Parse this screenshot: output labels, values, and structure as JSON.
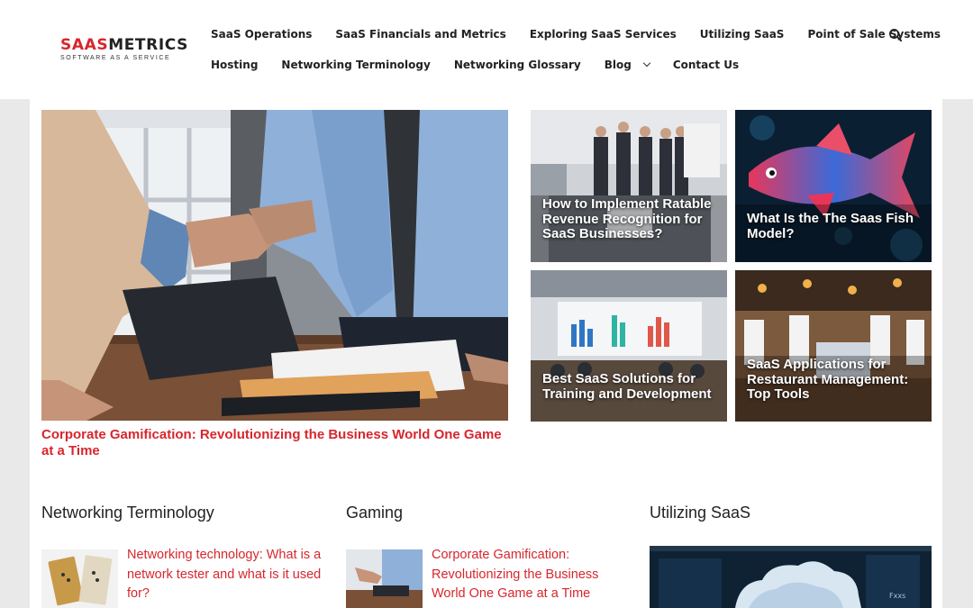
{
  "brand": {
    "logo_red": "SAAS",
    "logo_dark": "METRICS",
    "tagline": "SOFTWARE AS A SERVICE",
    "accent_color": "#d7262d"
  },
  "nav": {
    "row1": [
      "SaaS Operations",
      "SaaS Financials and Metrics",
      "Exploring SaaS Services",
      "Utilizing SaaS",
      "Point of Sale Systems"
    ],
    "row2": [
      "Hosting",
      "Networking Terminology",
      "Networking Glossary",
      "Blog",
      "Contact Us"
    ],
    "search_icon": "search-icon",
    "dropdown_icon": "chevron-down-icon"
  },
  "featured": {
    "hero_title": "Corporate Gamification: Revolutionizing the Business World One Game at a Time",
    "tiles": [
      "How to Implement Ratable Revenue Recognition for SaaS Businesses?",
      "What Is the The Saas Fish Model?",
      "Best SaaS Solutions for Training and Development",
      "SaaS Applications for Restaurant Management: Top Tools"
    ]
  },
  "sections": [
    {
      "title": "Networking Terminology",
      "post": "Networking technology: What is a network tester and what is it used for?"
    },
    {
      "title": "Gaming",
      "post": "Corporate Gamification: Revolutionizing the Business World One Game at a Time"
    },
    {
      "title": "Utilizing SaaS",
      "post": ""
    }
  ],
  "image_labels": {
    "dashboard_tag": "Fxxs"
  }
}
